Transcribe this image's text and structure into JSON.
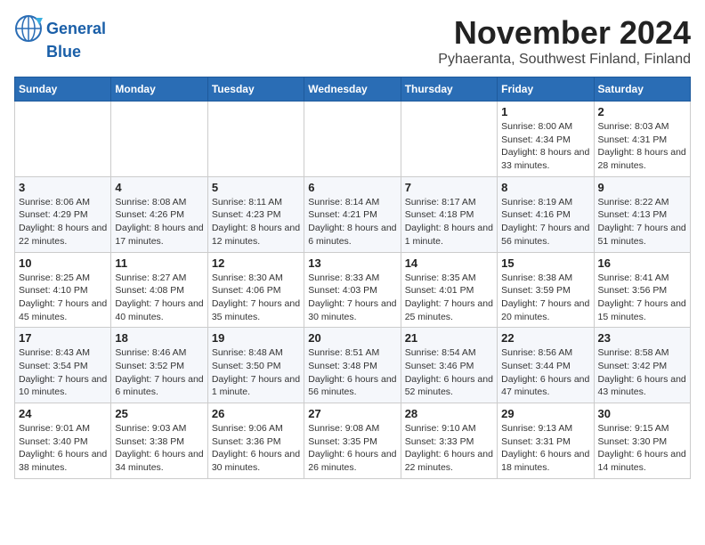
{
  "header": {
    "logo_line1": "General",
    "logo_line2": "Blue",
    "month": "November 2024",
    "location": "Pyhaeranta, Southwest Finland, Finland"
  },
  "weekdays": [
    "Sunday",
    "Monday",
    "Tuesday",
    "Wednesday",
    "Thursday",
    "Friday",
    "Saturday"
  ],
  "weeks": [
    [
      {
        "day": "",
        "info": ""
      },
      {
        "day": "",
        "info": ""
      },
      {
        "day": "",
        "info": ""
      },
      {
        "day": "",
        "info": ""
      },
      {
        "day": "",
        "info": ""
      },
      {
        "day": "1",
        "info": "Sunrise: 8:00 AM\nSunset: 4:34 PM\nDaylight: 8 hours and 33 minutes."
      },
      {
        "day": "2",
        "info": "Sunrise: 8:03 AM\nSunset: 4:31 PM\nDaylight: 8 hours and 28 minutes."
      }
    ],
    [
      {
        "day": "3",
        "info": "Sunrise: 8:06 AM\nSunset: 4:29 PM\nDaylight: 8 hours and 22 minutes."
      },
      {
        "day": "4",
        "info": "Sunrise: 8:08 AM\nSunset: 4:26 PM\nDaylight: 8 hours and 17 minutes."
      },
      {
        "day": "5",
        "info": "Sunrise: 8:11 AM\nSunset: 4:23 PM\nDaylight: 8 hours and 12 minutes."
      },
      {
        "day": "6",
        "info": "Sunrise: 8:14 AM\nSunset: 4:21 PM\nDaylight: 8 hours and 6 minutes."
      },
      {
        "day": "7",
        "info": "Sunrise: 8:17 AM\nSunset: 4:18 PM\nDaylight: 8 hours and 1 minute."
      },
      {
        "day": "8",
        "info": "Sunrise: 8:19 AM\nSunset: 4:16 PM\nDaylight: 7 hours and 56 minutes."
      },
      {
        "day": "9",
        "info": "Sunrise: 8:22 AM\nSunset: 4:13 PM\nDaylight: 7 hours and 51 minutes."
      }
    ],
    [
      {
        "day": "10",
        "info": "Sunrise: 8:25 AM\nSunset: 4:10 PM\nDaylight: 7 hours and 45 minutes."
      },
      {
        "day": "11",
        "info": "Sunrise: 8:27 AM\nSunset: 4:08 PM\nDaylight: 7 hours and 40 minutes."
      },
      {
        "day": "12",
        "info": "Sunrise: 8:30 AM\nSunset: 4:06 PM\nDaylight: 7 hours and 35 minutes."
      },
      {
        "day": "13",
        "info": "Sunrise: 8:33 AM\nSunset: 4:03 PM\nDaylight: 7 hours and 30 minutes."
      },
      {
        "day": "14",
        "info": "Sunrise: 8:35 AM\nSunset: 4:01 PM\nDaylight: 7 hours and 25 minutes."
      },
      {
        "day": "15",
        "info": "Sunrise: 8:38 AM\nSunset: 3:59 PM\nDaylight: 7 hours and 20 minutes."
      },
      {
        "day": "16",
        "info": "Sunrise: 8:41 AM\nSunset: 3:56 PM\nDaylight: 7 hours and 15 minutes."
      }
    ],
    [
      {
        "day": "17",
        "info": "Sunrise: 8:43 AM\nSunset: 3:54 PM\nDaylight: 7 hours and 10 minutes."
      },
      {
        "day": "18",
        "info": "Sunrise: 8:46 AM\nSunset: 3:52 PM\nDaylight: 7 hours and 6 minutes."
      },
      {
        "day": "19",
        "info": "Sunrise: 8:48 AM\nSunset: 3:50 PM\nDaylight: 7 hours and 1 minute."
      },
      {
        "day": "20",
        "info": "Sunrise: 8:51 AM\nSunset: 3:48 PM\nDaylight: 6 hours and 56 minutes."
      },
      {
        "day": "21",
        "info": "Sunrise: 8:54 AM\nSunset: 3:46 PM\nDaylight: 6 hours and 52 minutes."
      },
      {
        "day": "22",
        "info": "Sunrise: 8:56 AM\nSunset: 3:44 PM\nDaylight: 6 hours and 47 minutes."
      },
      {
        "day": "23",
        "info": "Sunrise: 8:58 AM\nSunset: 3:42 PM\nDaylight: 6 hours and 43 minutes."
      }
    ],
    [
      {
        "day": "24",
        "info": "Sunrise: 9:01 AM\nSunset: 3:40 PM\nDaylight: 6 hours and 38 minutes."
      },
      {
        "day": "25",
        "info": "Sunrise: 9:03 AM\nSunset: 3:38 PM\nDaylight: 6 hours and 34 minutes."
      },
      {
        "day": "26",
        "info": "Sunrise: 9:06 AM\nSunset: 3:36 PM\nDaylight: 6 hours and 30 minutes."
      },
      {
        "day": "27",
        "info": "Sunrise: 9:08 AM\nSunset: 3:35 PM\nDaylight: 6 hours and 26 minutes."
      },
      {
        "day": "28",
        "info": "Sunrise: 9:10 AM\nSunset: 3:33 PM\nDaylight: 6 hours and 22 minutes."
      },
      {
        "day": "29",
        "info": "Sunrise: 9:13 AM\nSunset: 3:31 PM\nDaylight: 6 hours and 18 minutes."
      },
      {
        "day": "30",
        "info": "Sunrise: 9:15 AM\nSunset: 3:30 PM\nDaylight: 6 hours and 14 minutes."
      }
    ]
  ]
}
